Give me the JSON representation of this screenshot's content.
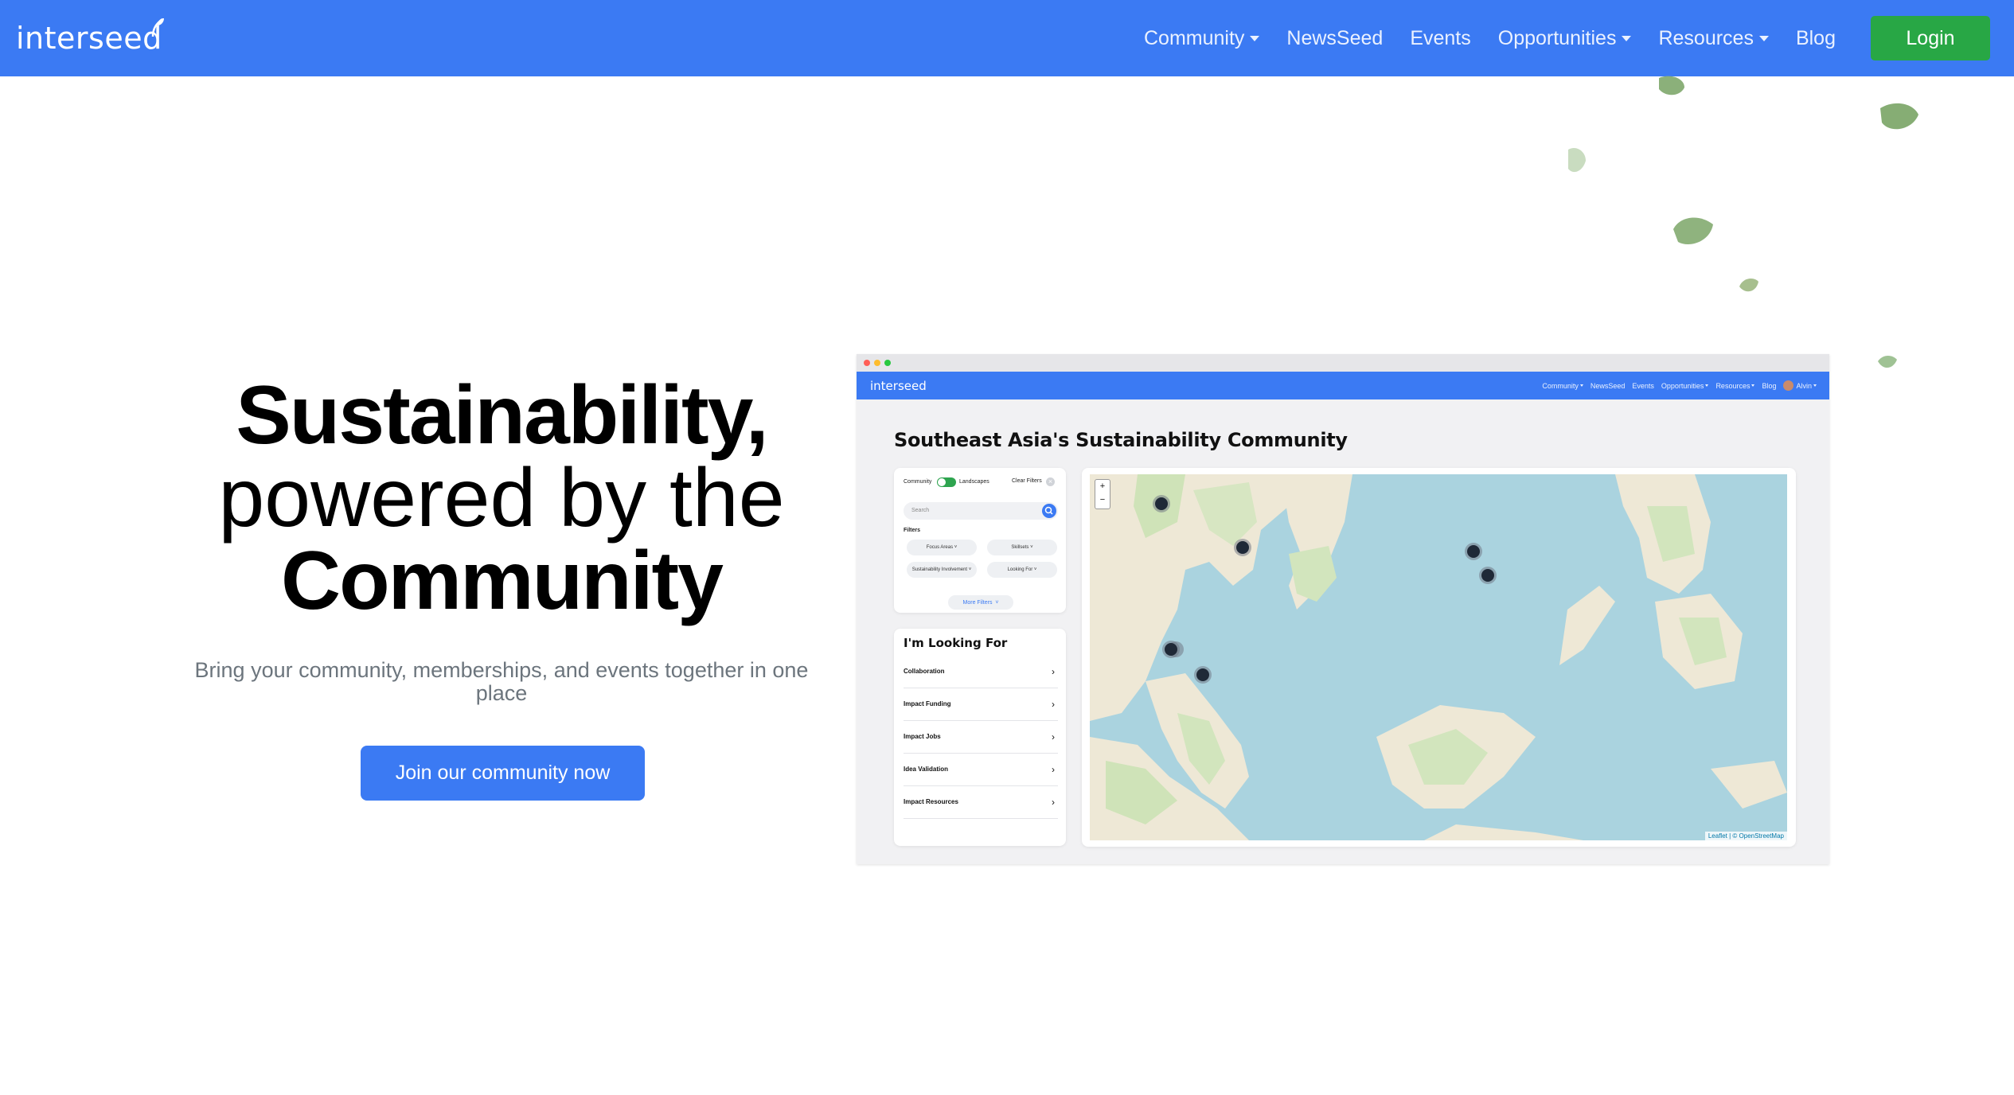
{
  "nav": {
    "brand": "interseed",
    "items": [
      {
        "label": "Community",
        "dropdown": true
      },
      {
        "label": "NewsSeed",
        "dropdown": false
      },
      {
        "label": "Events",
        "dropdown": false
      },
      {
        "label": "Opportunities",
        "dropdown": true
      },
      {
        "label": "Resources",
        "dropdown": true
      },
      {
        "label": "Blog",
        "dropdown": false
      }
    ],
    "login_label": "Login"
  },
  "hero": {
    "line1": "Sustainability,",
    "line2": "powered by the",
    "line3": "Community",
    "subtitle": "Bring your community, memberships, and events together in one place",
    "cta_label": "Join our community now"
  },
  "preview": {
    "brand": "interseed",
    "nav_items": [
      "Community",
      "NewsSeed",
      "Events",
      "Opportunities",
      "Resources",
      "Blog",
      "Alvin"
    ],
    "title": "Southeast Asia's Sustainability Community",
    "toggle_left": "Community",
    "toggle_right": "Landscapes",
    "clear_filters": "Clear Filters",
    "search_placeholder": "Search",
    "filters_label": "Filters",
    "chips": [
      "Focus Areas",
      "Skillsets",
      "Sustainability Involvement",
      "Looking For"
    ],
    "more_filters": "More Filters",
    "looking_title": "I'm Looking For",
    "looking_items": [
      "Collaboration",
      "Impact Funding",
      "Impact Jobs",
      "Idea Validation",
      "Impact Resources"
    ],
    "map_attribution": "Leaflet | © OpenStreetMap"
  },
  "colors": {
    "primary": "#3b7af3",
    "login": "#28a745",
    "subtitle": "#6c757d",
    "leaf": "#8bb07a"
  }
}
